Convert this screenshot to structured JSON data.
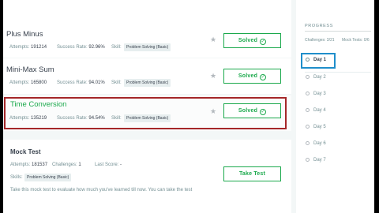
{
  "challenges": [
    {
      "title": "Plus Minus",
      "attempts_label": "Attempts:",
      "attempts": "191214",
      "success_label": "Success Rate:",
      "success_rate": "92.96%",
      "skill_label": "Skill:",
      "skill": "Problem Solving (Basic)",
      "button": "Solved"
    },
    {
      "title": "Mini-Max Sum",
      "attempts_label": "Attempts:",
      "attempts": "165800",
      "success_label": "Success Rate:",
      "success_rate": "94.01%",
      "skill_label": "Skill:",
      "skill": "Problem Solving (Basic)",
      "button": "Solved"
    },
    {
      "title": "Time Conversion",
      "attempts_label": "Attempts:",
      "attempts": "135219",
      "success_label": "Success Rate:",
      "success_rate": "94.54%",
      "skill_label": "Skill:",
      "skill": "Problem Solving (Basic)",
      "button": "Solved"
    }
  ],
  "mock_test": {
    "title": "Mock Test",
    "attempts_label": "Attempts:",
    "attempts": "181537",
    "challenges_label": "Challenges:",
    "challenges": "1",
    "last_score_label": "Last Score:",
    "last_score": "-",
    "skills_label": "Skills:",
    "skill": "Problem Solving (Basic)",
    "button": "Take Test",
    "description": "Take this mock test to evaluate how much you've learned till now. You can take the test"
  },
  "progress": {
    "label": "PROGRESS",
    "challenges_text": "Challenges: 3/21",
    "mock_tests_text": "Mock Tests: 0/6",
    "days": [
      "Day 1",
      "Day 2",
      "Day 3",
      "Day 4",
      "Day 5",
      "Day 6",
      "Day 7"
    ]
  },
  "colors": {
    "accent_green": "#1ba94c",
    "highlight_red": "#a52729",
    "focus_blue": "#1f8ecb"
  },
  "icons": {
    "star": "star-icon",
    "check": "check-circle-icon",
    "day_marker": "circle-icon"
  }
}
